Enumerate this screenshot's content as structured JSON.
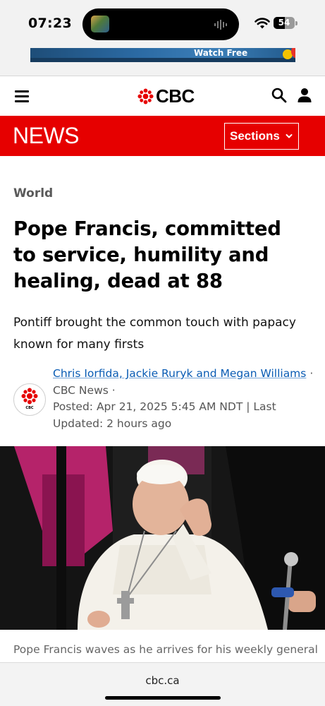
{
  "status_bar": {
    "time": "07:23",
    "battery_level": "54",
    "icons": [
      "now-playing-thumbnail",
      "audio-waveform-icon",
      "wifi-icon",
      "battery-icon"
    ]
  },
  "ad": {
    "banner_text": "Watch Free"
  },
  "header": {
    "logo_text": "CBC",
    "icons": [
      "menu-icon",
      "cbc-gem-icon",
      "search-icon",
      "account-icon"
    ]
  },
  "news_bar": {
    "title": "NEWS",
    "sections_label": "Sections",
    "background": "#e60000"
  },
  "article": {
    "category": "World",
    "headline": "Pope Francis, committed to service, humility and healing, dead at 88",
    "deck": "Pontiff brought the common touch with papacy known for many firsts",
    "authors": "Chris Iorfida, Jackie Ruryk and Megan Williams",
    "separator": "·",
    "outlet": "CBC News",
    "posted": "Posted: Apr 21, 2025 5:45 AM NDT | Last Updated: 2 hours ago",
    "avatar_label": "CBC",
    "caption": "Pope Francis waves as he arrives for his weekly general"
  },
  "browser": {
    "url": "cbc.ca"
  },
  "colors": {
    "accent_red": "#e60000",
    "link_blue": "#0a5cb4"
  }
}
